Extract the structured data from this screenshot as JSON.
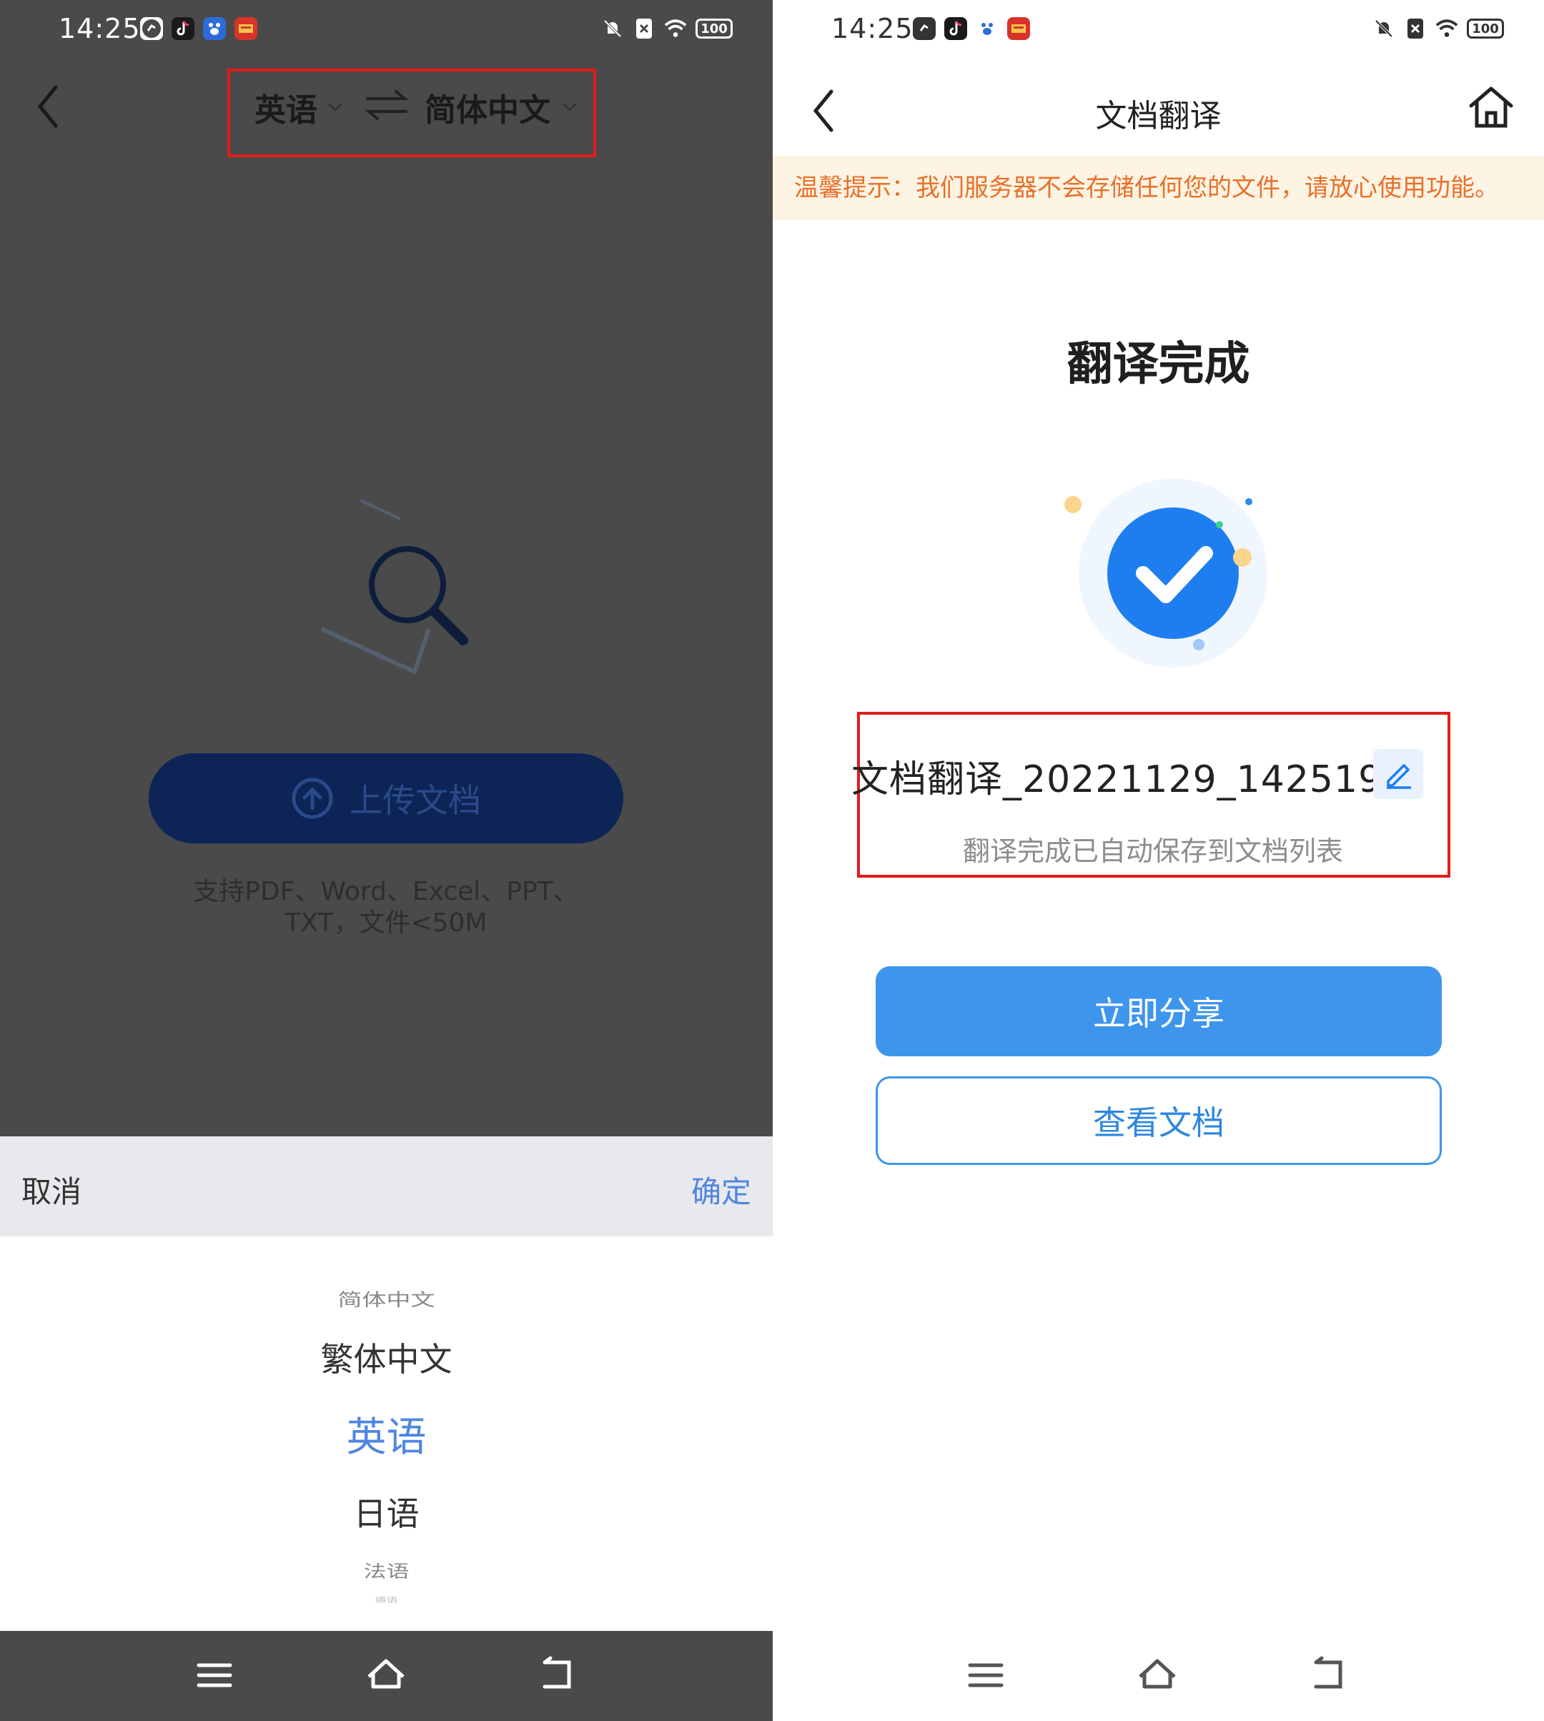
{
  "left": {
    "status": {
      "time": "14:25",
      "battery": "100"
    },
    "header": {
      "source_lang": "英语",
      "target_lang": "简体中文"
    },
    "upload": {
      "label": "上传文档",
      "support_line1": "支持PDF、Word、Excel、PPT、",
      "support_line2": "TXT，文件<50M"
    },
    "sheet": {
      "cancel": "取消",
      "confirm": "确定",
      "options": [
        "简体中文",
        "繁体中文",
        "英语",
        "日语",
        "法语",
        "德语"
      ],
      "selected": "英语"
    }
  },
  "right": {
    "status": {
      "time": "14:25",
      "battery": "100"
    },
    "header": {
      "title": "文档翻译"
    },
    "notice": "温馨提示：我们服务器不会存储任何您的文件，请放心使用功能。",
    "done_title": "翻译完成",
    "file_name": "文档翻译_20221129_142519",
    "save_note": "翻译完成已自动保存到文档列表",
    "share_label": "立即分享",
    "view_label": "查看文档"
  },
  "colors": {
    "accent_blue": "#3e95ec",
    "highlight_red": "#e31b1b",
    "notice_orange": "#e8702a",
    "picker_selected": "#4f86e0"
  }
}
